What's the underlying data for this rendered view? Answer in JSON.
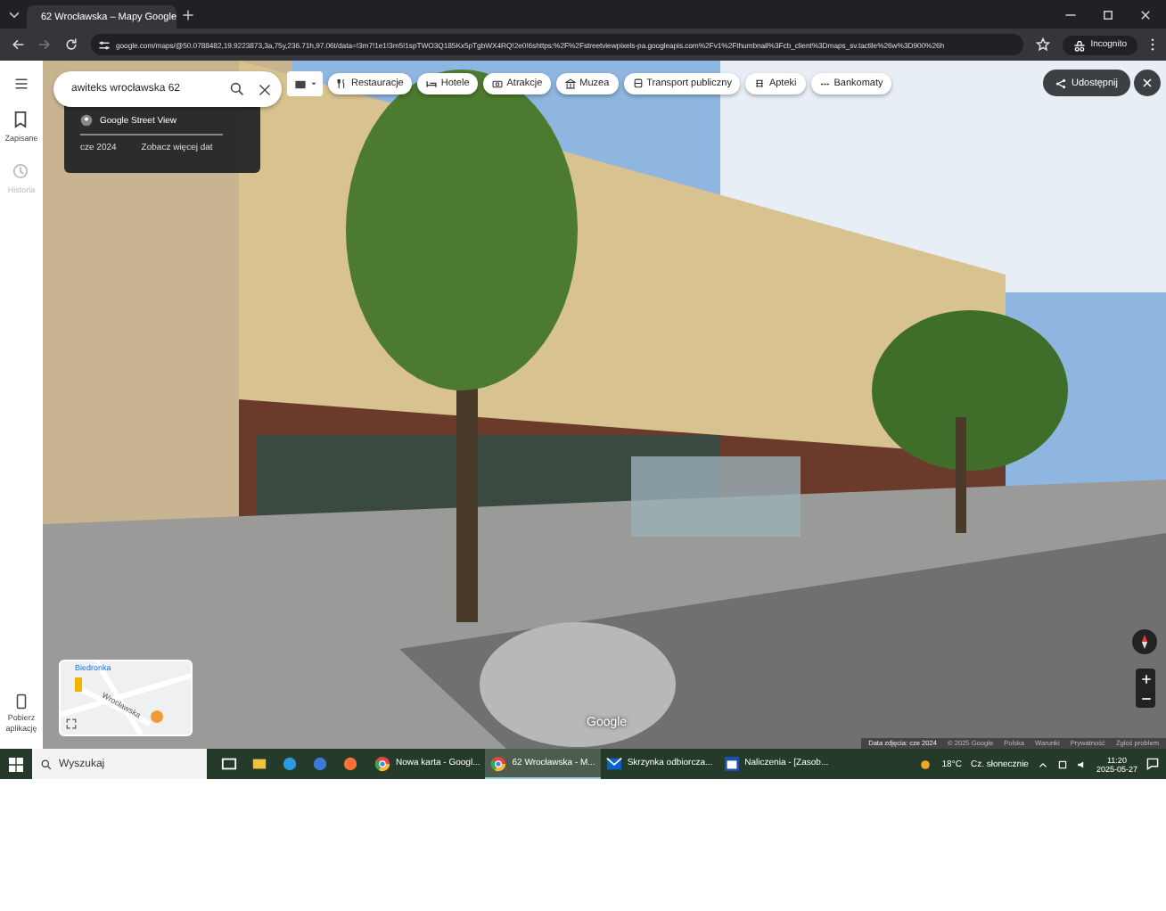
{
  "browser": {
    "tabs": [
      {
        "title": "62 Wrocławska – Mapy Google",
        "selected": true
      }
    ],
    "url": "google.com/maps/@50.0788482,19.9223873,3a,75y,236.71h,97.06t/data=!3m7!1e1!3m5!1spTWO3Q185Kx5pTgbWX4RQ!2e0!6shttps:%2F%2Fstreetviewpixels-pa.googleapis.com%2Fv1%2Fthumbnail%3Fcb_client%3Dmaps_sv.tactile%26w%3D900%26h",
    "profile": "Incognito"
  },
  "sidebar": {
    "items": [
      {
        "label": "Zapisane",
        "kind": "bookmark",
        "disabled": false
      },
      {
        "label": "Historia",
        "kind": "history",
        "disabled": true
      }
    ],
    "download": "Pobierz aplikację"
  },
  "search": {
    "value": "awiteks wrocławska 62"
  },
  "street_view_card": {
    "source": "Google Street View",
    "date": "cze 2024",
    "more_dates": "Zobacz więcej dat"
  },
  "chips": [
    {
      "label": "Restauracje",
      "kind": "food"
    },
    {
      "label": "Hotele",
      "kind": "bed"
    },
    {
      "label": "Atrakcje",
      "kind": "camera"
    },
    {
      "label": "Muzea",
      "kind": "museum"
    },
    {
      "label": "Transport publiczny",
      "kind": "bus"
    },
    {
      "label": "Apteki",
      "kind": "pharmacy"
    },
    {
      "label": "Bankomaty",
      "kind": "cash"
    }
  ],
  "share": "Udostępnij",
  "minimap": {
    "labels": [
      "Biedronka",
      "Wrocławska"
    ]
  },
  "google_logo": "Google",
  "attribution": [
    "Data zdjęcia: cze 2024",
    "© 2025 Google",
    "Polska",
    "Warunki",
    "Prywatność",
    "Zgłoś problem"
  ],
  "taskbar": {
    "search_placeholder": "Wyszukaj",
    "apps": [
      {
        "label": "Nowa karta - Googl...",
        "kind": "chrome",
        "selected": false
      },
      {
        "label": "62 Wrocławska - M...",
        "kind": "chrome",
        "selected": true
      },
      {
        "label": "Skrzynka odbiorcza...",
        "kind": "outlook",
        "selected": false
      },
      {
        "label": "Naliczenia - [Zasob...",
        "kind": "app",
        "selected": false
      }
    ],
    "temperature": "18°C",
    "weather": "Cz. słonecznie",
    "time": "11:20",
    "date": "2025-05-27"
  }
}
